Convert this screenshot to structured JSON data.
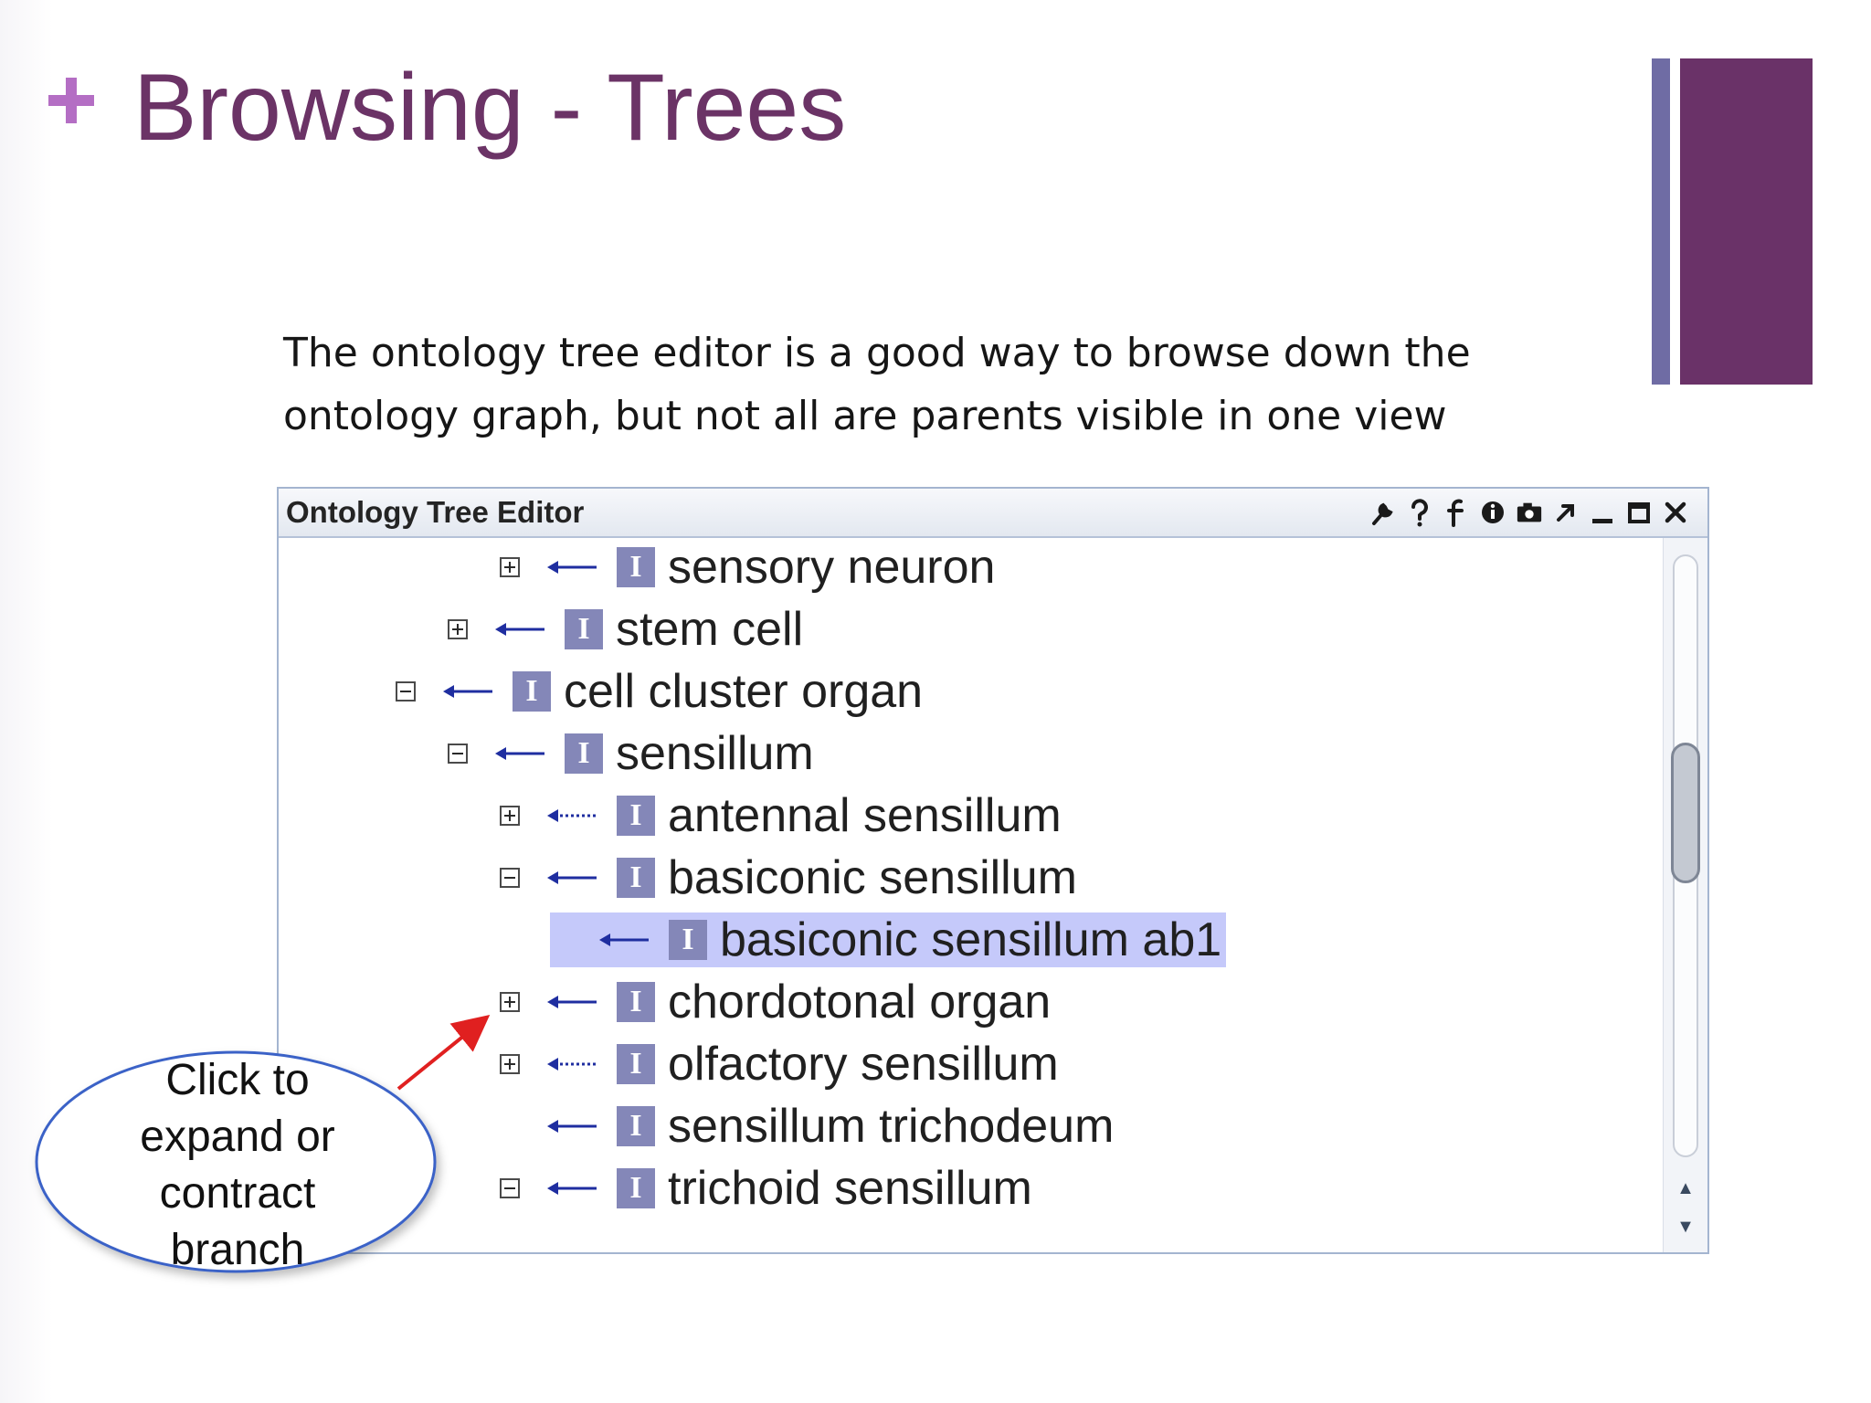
{
  "slide": {
    "title": "Browsing - Trees",
    "body_line1": "The ontology tree editor is a good way to browse down the",
    "body_line2": "ontology graph,  but not all are parents visible in one view"
  },
  "window": {
    "title": "Ontology Tree Editor",
    "toolbar_icons": [
      "wrench-icon",
      "help-icon",
      "filter-icon",
      "info-icon",
      "camera-icon",
      "popout-icon",
      "minimize-icon",
      "maximize-icon",
      "close-icon"
    ],
    "type_icon_letter": "I"
  },
  "tree": [
    {
      "label": "sensory neuron",
      "level": 2,
      "expander": "plus",
      "arrow": "solid"
    },
    {
      "label": "stem cell",
      "level": 1,
      "expander": "plus",
      "arrow": "solid"
    },
    {
      "label": "cell cluster organ",
      "level": 0,
      "expander": "minus",
      "arrow": "solid"
    },
    {
      "label": "sensillum",
      "level": 1,
      "expander": "minus",
      "arrow": "solid"
    },
    {
      "label": "antennal sensillum",
      "level": 2,
      "expander": "plus",
      "arrow": "dotted"
    },
    {
      "label": "basiconic sensillum",
      "level": 2,
      "expander": "minus",
      "arrow": "solid"
    },
    {
      "label": "basiconic sensillum ab1",
      "level": 3,
      "expander": "none",
      "arrow": "solid",
      "selected": true
    },
    {
      "label": "chordotonal organ",
      "level": 2,
      "expander": "plus",
      "arrow": "solid"
    },
    {
      "label": "olfactory sensillum",
      "level": 2,
      "expander": "plus",
      "arrow": "dotted"
    },
    {
      "label": "sensillum trichodeum",
      "level": 2,
      "expander": "none",
      "arrow": "solid"
    },
    {
      "label": "trichoid sensillum",
      "level": 2,
      "expander": "minus",
      "arrow": "solid"
    }
  ],
  "callout": {
    "line1": "Click to",
    "line2": "expand or",
    "line3": "contract",
    "line4": "branch"
  },
  "colors": {
    "title": "#6b3366",
    "accent_plus": "#b46ec4",
    "accent_bar_thin": "#6f6ca4",
    "accent_bar_thick": "#6a3268",
    "arrow": "#1f2ea0",
    "selection": "#c5c9fa",
    "type_icon": "#8487b8",
    "callout_border": "#3b62c7",
    "pointer_arrow": "#e02020"
  }
}
